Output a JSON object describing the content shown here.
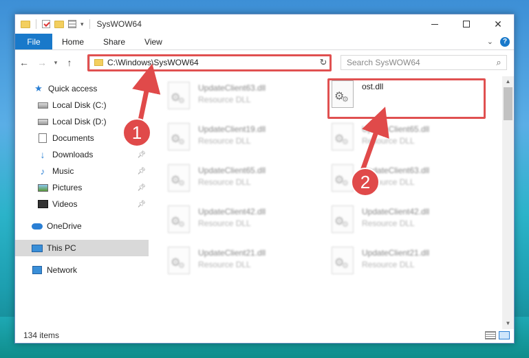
{
  "window": {
    "title": "SysWOW64",
    "close_glyph": "✕"
  },
  "ribbon": {
    "file": "File",
    "tabs": [
      "Home",
      "Share",
      "View"
    ]
  },
  "address": {
    "path": "C:\\Windows\\SysWOW64"
  },
  "search": {
    "placeholder": "Search SysWOW64"
  },
  "sidebar": {
    "quick_access": "Quick access",
    "local_c": "Local Disk (C:)",
    "local_d": "Local Disk (D:)",
    "documents": "Documents",
    "downloads": "Downloads",
    "music": "Music",
    "pictures": "Pictures",
    "videos": "Videos",
    "onedrive": "OneDrive",
    "this_pc": "This PC",
    "network": "Network"
  },
  "files": [
    {
      "name": "UpdateClient63.dll",
      "type": "Resource DLL"
    },
    {
      "name": "ost.dll",
      "type": ""
    },
    {
      "name": "UpdateClient19.dll",
      "type": "Resource DLL"
    },
    {
      "name": "UpdateClient65.dll",
      "type": "Resource DLL"
    },
    {
      "name": "UpdateClient65.dll",
      "type": "Resource DLL"
    },
    {
      "name": "UpdateClient63.dll",
      "type": "Resource DLL"
    },
    {
      "name": "UpdateClient42.dll",
      "type": "Resource DLL"
    },
    {
      "name": "UpdateClient42.dll",
      "type": "Resource DLL"
    },
    {
      "name": "UpdateClient21.dll",
      "type": "Resource DLL"
    },
    {
      "name": "UpdateClient21.dll",
      "type": "Resource DLL"
    }
  ],
  "status": {
    "item_count": "134 items"
  },
  "annotations": {
    "step1": "1",
    "step2": "2",
    "color": "#e04a4a"
  }
}
